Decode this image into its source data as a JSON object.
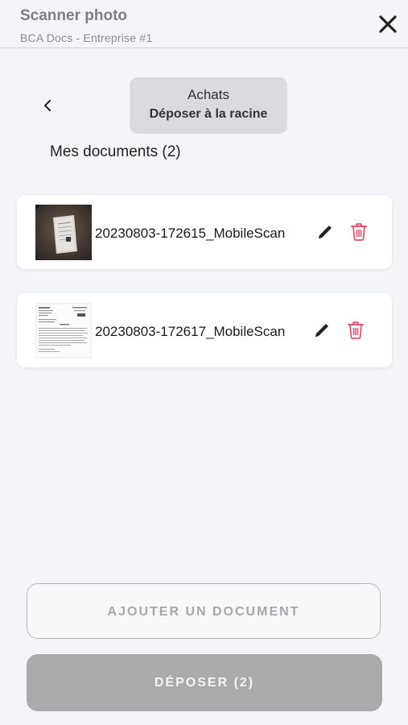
{
  "header": {
    "title": "Scanner photo",
    "subtitle": "BCA Docs - Entreprise #1"
  },
  "folder": {
    "name": "Achats",
    "action": "Déposer à la racine"
  },
  "documents_title": "Mes documents (2)",
  "documents": [
    {
      "name": "20230803-172615_MobileScan",
      "icon": "photo-thumbnail"
    },
    {
      "name": "20230803-172617_MobileScan",
      "icon": "document-thumbnail"
    }
  ],
  "buttons": {
    "add": "AJOUTER UN DOCUMENT",
    "submit": "DÉPOSER (2)"
  },
  "colors": {
    "background": "#f3f5f9",
    "delete": "#e0566a",
    "submit_bg": "#a9aaab"
  }
}
